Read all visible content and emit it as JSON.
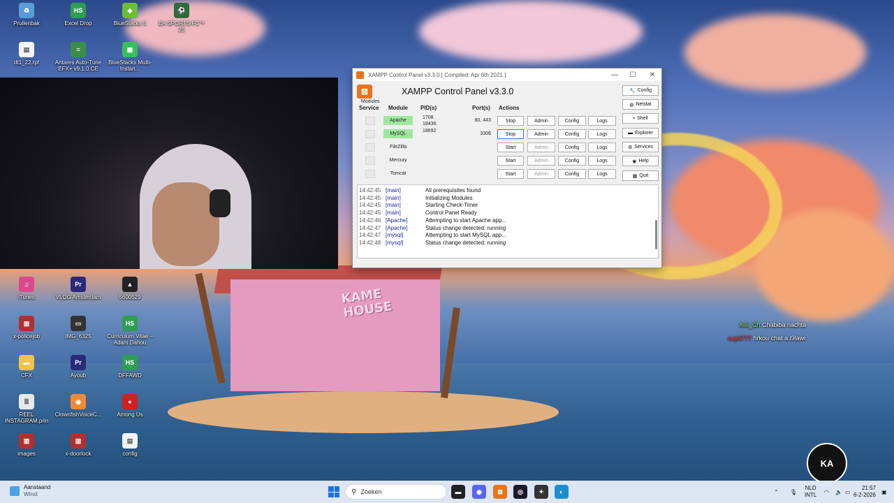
{
  "desktop_icons": [
    {
      "label": "Prullenbak",
      "icon": "recycle-bin-icon",
      "color": "#5a9bd8",
      "glyph": "♻"
    },
    {
      "label": "Excel Drop",
      "icon": "hs-icon",
      "color": "#2f9d52",
      "glyph": "HS"
    },
    {
      "label": "BlueStacks 5",
      "icon": "bluestacks-icon",
      "color": "#6bbd3a",
      "glyph": "◆"
    },
    {
      "label": "EA SPORTS FC™ 25",
      "icon": "ea-fc-icon",
      "color": "#2e6b3a",
      "glyph": "⚽"
    },
    {
      "label": "dt1_22.rpf",
      "icon": "file-icon",
      "color": "#f4f4f4",
      "glyph": "▤"
    },
    {
      "label": "Antares Auto-Tune EFX+ v9.1.0 CE",
      "icon": "autotune-icon",
      "color": "#3b8e4a",
      "glyph": "≡"
    },
    {
      "label": "BlueStacks Multi-Instan...",
      "icon": "bluestacks-multi-icon",
      "color": "#34c05a",
      "glyph": "▦"
    },
    {
      "label": "iTunes",
      "icon": "itunes-icon",
      "color": "#d94a8a",
      "glyph": "♫"
    },
    {
      "label": "VLOG Amsterdam",
      "icon": "premiere-icon",
      "color": "#2a2a7a",
      "glyph": "Pr"
    },
    {
      "label": "5600529",
      "icon": "image-file-icon",
      "color": "#222",
      "glyph": "▲"
    },
    {
      "label": "x-policejob",
      "icon": "winrar-icon",
      "color": "#b03030",
      "glyph": "▥"
    },
    {
      "label": "IMG_6325",
      "icon": "photo-icon",
      "color": "#333",
      "glyph": "▭"
    },
    {
      "label": "Curriculum Vitae – Adam Dahou",
      "icon": "hs-icon",
      "color": "#2f9d52",
      "glyph": "HS"
    },
    {
      "label": "CFX",
      "icon": "folder-icon",
      "color": "#f2c24a",
      "glyph": "▬"
    },
    {
      "label": "Ayoub",
      "icon": "premiere-icon",
      "color": "#2a2a7a",
      "glyph": "Pr"
    },
    {
      "label": "DFFAWD",
      "icon": "hs-icon",
      "color": "#2f9d52",
      "glyph": "HS"
    },
    {
      "label": "REEL INSTAGRAM.prin",
      "icon": "text-file-icon",
      "color": "#e8e8e8",
      "glyph": "≣"
    },
    {
      "label": "ClownfishVoiceC...",
      "icon": "clownfish-icon",
      "color": "#f08a3a",
      "glyph": "◉"
    },
    {
      "label": "Among Us",
      "icon": "among-us-icon",
      "color": "#d02020",
      "glyph": "●"
    },
    {
      "label": "images",
      "icon": "winrar-icon",
      "color": "#b03030",
      "glyph": "▥"
    },
    {
      "label": "x-doorlock",
      "icon": "winrar-icon",
      "color": "#b03030",
      "glyph": "▥"
    },
    {
      "label": "config",
      "icon": "file-icon",
      "color": "#f4f4f4",
      "glyph": "▤"
    }
  ],
  "wallpaper": {
    "sign_line1": "KAME",
    "sign_line2": "HOUSE"
  },
  "xampp": {
    "window_title": "XAMPP Control Panel v3.3.0   [ Compiled: Apr 6th 2021 ]",
    "heading": "XAMPP Control Panel v3.3.0",
    "modules_label": "Modules",
    "columns": {
      "service": "Service",
      "module": "Module",
      "pid": "PID(s)",
      "port": "Port(s)",
      "actions": "Actions"
    },
    "rows": [
      {
        "module": "Apache",
        "pid_line1": "1708",
        "pid_line2": "18436",
        "ports": "80, 443",
        "action": "Stop",
        "admin": "Admin",
        "config": "Config",
        "logs": "Logs",
        "running": true
      },
      {
        "module": "MySQL",
        "pid_line1": "18692",
        "pid_line2": "",
        "ports": "3306",
        "action": "Stop",
        "admin": "Admin",
        "config": "Config",
        "logs": "Logs",
        "running": true
      },
      {
        "module": "FileZilla",
        "pid_line1": "",
        "pid_line2": "",
        "ports": "",
        "action": "Start",
        "admin": "Admin",
        "config": "Config",
        "logs": "Logs",
        "running": false
      },
      {
        "module": "Mercury",
        "pid_line1": "",
        "pid_line2": "",
        "ports": "",
        "action": "Start",
        "admin": "Admin",
        "config": "Config",
        "logs": "Logs",
        "running": false
      },
      {
        "module": "Tomcat",
        "pid_line1": "",
        "pid_line2": "",
        "ports": "",
        "action": "Start",
        "admin": "Admin",
        "config": "Config",
        "logs": "Logs",
        "running": false
      }
    ],
    "side_buttons": [
      {
        "label": "Config",
        "icon": "wrench-icon",
        "glyph": "🔧"
      },
      {
        "label": "Netstat",
        "icon": "globe-icon",
        "glyph": "◍"
      },
      {
        "label": "Shell",
        "icon": "terminal-icon",
        "glyph": "▪"
      },
      {
        "label": "Explorer",
        "icon": "folder-icon",
        "glyph": "▬"
      },
      {
        "label": "Services",
        "icon": "services-icon",
        "glyph": "⚙"
      },
      {
        "label": "Help",
        "icon": "help-icon",
        "glyph": "◉"
      },
      {
        "label": "Quit",
        "icon": "quit-icon",
        "glyph": "▦"
      }
    ],
    "log": [
      {
        "time": "14:42:45",
        "module": "[main]",
        "message": "All prerequisites found"
      },
      {
        "time": "14:42:45",
        "module": "[main]",
        "message": "Initializing Modules"
      },
      {
        "time": "14:42:45",
        "module": "[main]",
        "message": "Starting Check-Timer"
      },
      {
        "time": "14:42:45",
        "module": "[main]",
        "message": "Control Panel Ready"
      },
      {
        "time": "14:42:46",
        "module": "[Apache]",
        "message": "Attempting to start Apache app..."
      },
      {
        "time": "14:42:47",
        "module": "[Apache]",
        "message": "Status change detected: running"
      },
      {
        "time": "14:42:47",
        "module": "[mysql]",
        "message": "Attempting to start MySQL app..."
      },
      {
        "time": "14:42:48",
        "module": "[mysql]",
        "message": "Status change detected: running"
      }
    ]
  },
  "chat": [
    {
      "user": "Aiiii_Ch",
      "message": "Chabiba nachta"
    },
    {
      "user": "oujdi777",
      "message": "hrkou chat a l9lawi"
    }
  ],
  "stream_logo_text": "KA",
  "taskbar": {
    "weather_line1": "Aanstaand",
    "weather_line2": "Winst",
    "search_placeholder": "Zoeken",
    "apps": [
      {
        "icon": "file-explorer-icon",
        "color": "#222",
        "glyph": "▬"
      },
      {
        "icon": "discord-icon",
        "color": "#5865f2",
        "glyph": "◉"
      },
      {
        "icon": "xampp-icon",
        "color": "#e8741c",
        "glyph": "⊠"
      },
      {
        "icon": "obs-icon",
        "color": "#1a1a2a",
        "glyph": "◎"
      },
      {
        "icon": "davinci-icon",
        "color": "#333",
        "glyph": "✦"
      },
      {
        "icon": "edge-icon",
        "color": "#1a8fd0",
        "glyph": "◐"
      }
    ],
    "lang_line1": "NLD",
    "lang_line2": "INTL",
    "time": "21:57",
    "date": "6-2-2026"
  }
}
